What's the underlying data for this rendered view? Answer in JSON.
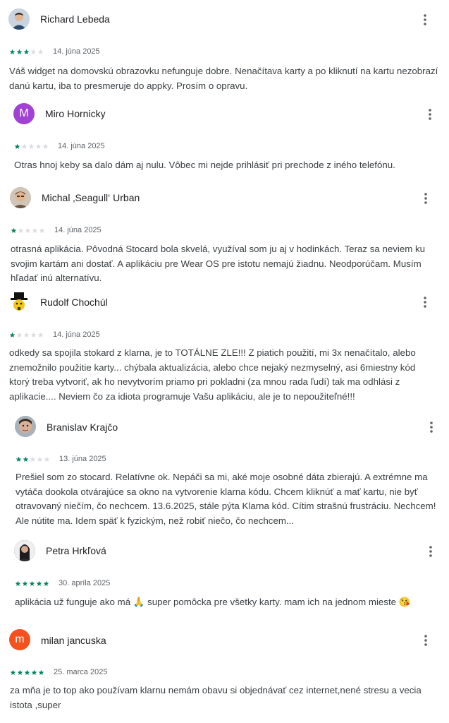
{
  "colors": {
    "star_filled": "#01875f",
    "star_empty": "#dadce0",
    "text": "#3c4043",
    "secondary": "#5f6368"
  },
  "reviews": [
    {
      "author": "Richard Lebeda",
      "avatar": {
        "type": "photo",
        "bg": "#3a5a7a",
        "initial": ""
      },
      "rating": 3,
      "date": "14. júna 2025",
      "text": "Váš widget na domovskú obrazovku nefunguje dobre. Nenačítava karty a po kliknutí na kartu nezobrazí danú kartu, iba to presmeruje do appky. Prosím o opravu."
    },
    {
      "author": "Miro Hornicky",
      "avatar": {
        "type": "initial",
        "bg": "#a142d4",
        "initial": "M"
      },
      "rating": 1,
      "date": "14. júna 2025",
      "text": "Otras hnoj keby sa dalo dám aj nulu. Vôbec mi nejde prihlásiť pri prechode z iného telefónu."
    },
    {
      "author": "Michal ‚Seagull‘ Urban",
      "avatar": {
        "type": "photo",
        "bg": "#7a6a5a",
        "initial": ""
      },
      "rating": 1,
      "date": "14. júna 2025",
      "text": "otrasná aplikácia. Pôvodná Stocard bola skvelá, využíval som ju aj v hodinkách. Teraz sa neviem ku svojim kartám ani dostať. A aplikáciu pre Wear OS pre istotu nemajú žiadnu. Neodporúčam. Musím hľadať inú alternatívu."
    },
    {
      "author": "Rudolf Chochúl",
      "avatar": {
        "type": "emoji",
        "bg": "#ffffff",
        "initial": ""
      },
      "rating": 1,
      "date": "14. júna 2025",
      "text": "odkedy sa spojila stokard z klarna, je to TOTÁLNE ZLE!!! Z piatich použití, mi 3x nenačítalo, alebo znemožnilo použitie karty... chýbala aktualizácia, alebo chce nejaký nezmyselný, asi 6miestny kód ktorý treba vytvoriť, ak ho nevytvorím priamo pri pokladni (za mnou rada ľudí) tak ma odhlási z aplikacie.... Neviem čo za idiota programuje Vašu aplikáciu, ale je to nepoužiteľné!!!"
    },
    {
      "author": "Branislav Krajčo",
      "avatar": {
        "type": "photo",
        "bg": "#5a6a7a",
        "initial": ""
      },
      "rating": 2,
      "date": "13. júna 2025",
      "text": "Prešiel som zo stocard. Relatívne ok. Nepáči sa mi, aké moje osobné dáta zbierajú. A extrémne ma vytáča dookola otvárajúce sa okno na vytvorenie klarna kódu. Chcem kliknúť a mať kartu, nie byť otravovaný niečím, čo nechcem. 13.6.2025, stále pýta Klarna kód. Cítim strašnú frustráciu. Nechcem! Ale nútite ma. Idem späť k fyzickým, než robiť niečo, čo nechcem..."
    },
    {
      "author": "Petra Hrkľová",
      "avatar": {
        "type": "photo",
        "bg": "#2a2a2e",
        "initial": ""
      },
      "rating": 5,
      "date": "30. apríla 2025",
      "text": "aplikácia už funguje ako má 🙏 super pomôcka pre všetky karty. mam ich na jednom mieste 😘"
    },
    {
      "author": "milan jancuska",
      "avatar": {
        "type": "initial",
        "bg": "#f4511e",
        "initial": "m"
      },
      "rating": 5,
      "date": "25. marca 2025",
      "text": "za mňa je to top ako používam klarnu nemám obavu si objednávať cez internet,nené stresu a vecia istota ,super"
    }
  ]
}
